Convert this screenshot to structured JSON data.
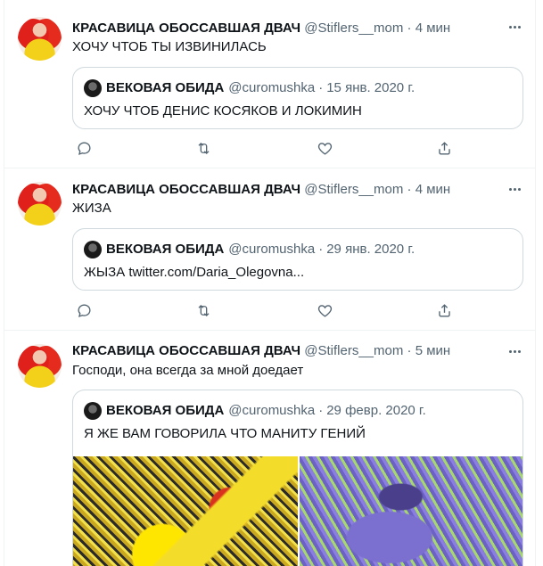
{
  "tweets": [
    {
      "name": "КРАСАВИЦА ОБОССАВШАЯ ДВАЧ",
      "handle": "@Stiflers__mom",
      "dot": "·",
      "time": "4 мин",
      "text": "ХОЧУ ЧТОБ ТЫ ИЗВИНИЛАСЬ",
      "quote": {
        "name": "ВЕКОВАЯ ОБИДА",
        "handle": "@curomushka",
        "dot": "·",
        "date": "15 янв. 2020 г.",
        "text": "ХОЧУ ЧТОБ ДЕНИС КОСЯКОВ И ЛОКИМИН"
      }
    },
    {
      "name": "КРАСАВИЦА ОБОССАВШАЯ ДВАЧ",
      "handle": "@Stiflers__mom",
      "dot": "·",
      "time": "4 мин",
      "text": "ЖИЗА",
      "quote": {
        "name": "ВЕКОВАЯ ОБИДА",
        "handle": "@curomushka",
        "dot": "·",
        "date": "29 янв. 2020 г.",
        "text": "ЖЫЗА twitter.com/Daria_Olegovna..."
      }
    },
    {
      "name": "КРАСАВИЦА ОБОССАВШАЯ ДВАЧ",
      "handle": "@Stiflers__mom",
      "dot": "·",
      "time": "5 мин",
      "text": "Господи, она всегда за мной доедает",
      "quote": {
        "name": "ВЕКОВАЯ ОБИДА",
        "handle": "@curomushka",
        "dot": "·",
        "date": "29 февр. 2020 г.",
        "text": "Я ЖЕ ВАМ ГОВОРИЛА ЧТО МАНИТУ ГЕНИЙ"
      }
    }
  ],
  "icons": {
    "more": "more-dots-icon",
    "reply": "reply-icon",
    "retweet": "retweet-icon",
    "like": "like-icon",
    "share": "share-icon"
  },
  "colors": {
    "secondary_text": "#536471",
    "border": "#cfd9de",
    "divider": "#eff3f4"
  }
}
